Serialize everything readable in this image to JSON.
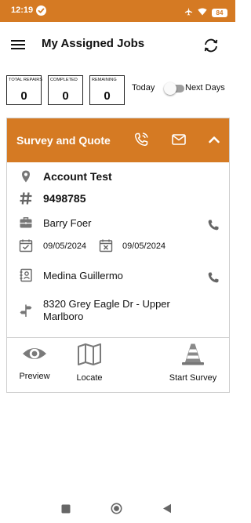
{
  "status_bar": {
    "time": "12:19",
    "battery": "84",
    "background": "#d57a23"
  },
  "header": {
    "title": "My Assigned Jobs",
    "menu_icon": "hamburger-menu-icon",
    "refresh_icon": "refresh-icon"
  },
  "stats": [
    {
      "label": "Total Repairs",
      "value": "0"
    },
    {
      "label": "Completed",
      "value": "0"
    },
    {
      "label": "Remaining",
      "value": "0"
    }
  ],
  "toggle": {
    "left_label": "Today",
    "right_label": "Next Days",
    "on": false
  },
  "job_card": {
    "title": "Survey and Quote",
    "header_color": "#d57a23",
    "account": "Account Test",
    "job_number": "9498785",
    "contact": "Barry Foer",
    "start_date": "09/05/2024",
    "end_date": "09/05/2024",
    "owner": "Medina Guillermo",
    "address": "8320 Grey Eagle Dr - Upper Marlboro",
    "actions": [
      {
        "label": "Preview",
        "icon": "eye-icon"
      },
      {
        "label": "Locate",
        "icon": "map-icon"
      },
      {
        "label": "Start Survey",
        "icon": "traffic-cone-icon"
      }
    ]
  }
}
